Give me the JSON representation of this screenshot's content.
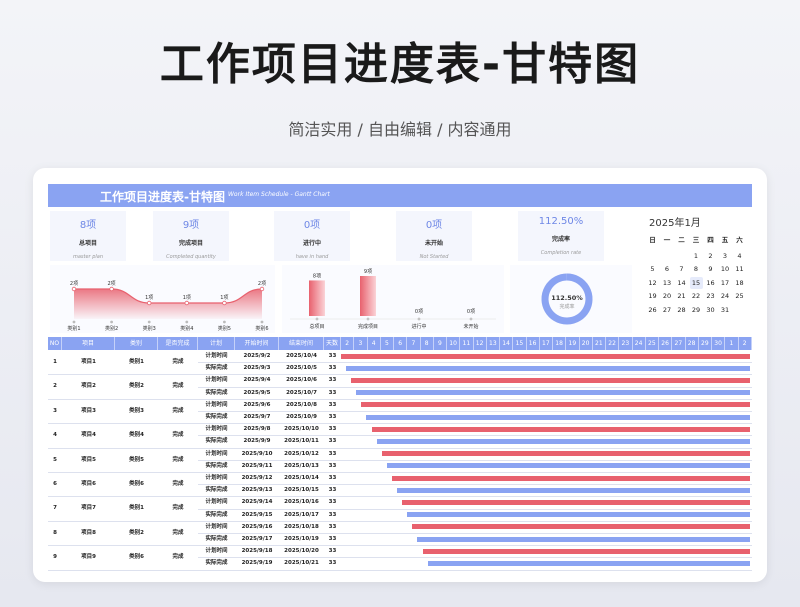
{
  "page": {
    "title": "工作项目进度表-甘特图",
    "subtitle": "简洁实用 / 自由编辑 / 内容通用"
  },
  "banner": {
    "title": "工作项目进度表-甘特图",
    "subtitle": "Work Item Schedule - Gantt Chart"
  },
  "kpis": [
    {
      "value": "8项",
      "label": "总项目",
      "label_en": "master plan"
    },
    {
      "value": "9项",
      "label": "完成项目",
      "label_en": "Completed quantity"
    },
    {
      "value": "0项",
      "label": "进行中",
      "label_en": "have in hand"
    },
    {
      "value": "0项",
      "label": "未开始",
      "label_en": "Not Started"
    },
    {
      "value": "112.50%",
      "label": "完成率",
      "label_en": "Completion rate"
    }
  ],
  "calendar": {
    "title": "2025年1月",
    "weekdays": [
      "日",
      "一",
      "二",
      "三",
      "四",
      "五",
      "六"
    ],
    "weeks": [
      [
        "",
        "",
        "",
        "1",
        "2",
        "3",
        "4"
      ],
      [
        "5",
        "6",
        "7",
        "8",
        "9",
        "10",
        "11"
      ],
      [
        "12",
        "13",
        "14",
        "15",
        "16",
        "17",
        "18"
      ],
      [
        "19",
        "20",
        "21",
        "22",
        "23",
        "24",
        "25"
      ],
      [
        "26",
        "27",
        "28",
        "29",
        "30",
        "31",
        ""
      ]
    ],
    "highlight": "15"
  },
  "chart_data": [
    {
      "type": "area",
      "categories": [
        "类别1",
        "类别2",
        "类别3",
        "类别4",
        "类别5",
        "类别6"
      ],
      "values": [
        2,
        2,
        1,
        1,
        1,
        2
      ],
      "data_labels": [
        "2项",
        "2项",
        "1项",
        "1项",
        "1项",
        "2项"
      ],
      "color": "#e8616e"
    },
    {
      "type": "bar",
      "categories": [
        "总项目",
        "完成项目",
        "进行中",
        "未开始"
      ],
      "values": [
        8,
        9,
        0,
        0
      ],
      "data_labels": [
        "8项",
        "9项",
        "0项",
        "0项"
      ],
      "color": "#e8616e"
    },
    {
      "type": "pie",
      "center_value": "112.50%",
      "center_label": "完成率",
      "value": 1.125,
      "colors": [
        "#8aa3f2",
        "#dfe5f8"
      ]
    }
  ],
  "gantt": {
    "headers": [
      "NO",
      "项目",
      "类别",
      "是否完成",
      "计划",
      "开始时间",
      "结束时间",
      "天数"
    ],
    "day_columns": [
      "2",
      "3",
      "4",
      "5",
      "6",
      "7",
      "8",
      "9",
      "10",
      "11",
      "12",
      "13",
      "14",
      "15",
      "16",
      "17",
      "18",
      "19",
      "20",
      "21",
      "22",
      "23",
      "24",
      "25",
      "26",
      "27",
      "28",
      "29",
      "30",
      "1",
      "2"
    ],
    "plan_color": "#e8616e",
    "actual_color": "#8aa3f2",
    "rows": [
      {
        "no": "1",
        "project": "项目1",
        "category": "类别1",
        "done": "完成",
        "plan": {
          "label": "计划时间",
          "start": "2025/9/2",
          "end": "2025/10/4",
          "days": "33",
          "offset": 0
        },
        "actual": {
          "label": "实际完成",
          "start": "2025/9/3",
          "end": "2025/10/5",
          "days": "33",
          "offset": 1
        }
      },
      {
        "no": "2",
        "project": "项目2",
        "category": "类别2",
        "done": "完成",
        "plan": {
          "label": "计划时间",
          "start": "2025/9/4",
          "end": "2025/10/6",
          "days": "33",
          "offset": 2
        },
        "actual": {
          "label": "实际完成",
          "start": "2025/9/5",
          "end": "2025/10/7",
          "days": "33",
          "offset": 3
        }
      },
      {
        "no": "3",
        "project": "项目3",
        "category": "类别3",
        "done": "完成",
        "plan": {
          "label": "计划时间",
          "start": "2025/9/6",
          "end": "2025/10/8",
          "days": "33",
          "offset": 4
        },
        "actual": {
          "label": "实际完成",
          "start": "2025/9/7",
          "end": "2025/10/9",
          "days": "33",
          "offset": 5
        }
      },
      {
        "no": "4",
        "project": "项目4",
        "category": "类别4",
        "done": "完成",
        "plan": {
          "label": "计划时间",
          "start": "2025/9/8",
          "end": "2025/10/10",
          "days": "33",
          "offset": 6
        },
        "actual": {
          "label": "实际完成",
          "start": "2025/9/9",
          "end": "2025/10/11",
          "days": "33",
          "offset": 7
        }
      },
      {
        "no": "5",
        "project": "项目5",
        "category": "类别5",
        "done": "完成",
        "plan": {
          "label": "计划时间",
          "start": "2025/9/10",
          "end": "2025/10/12",
          "days": "33",
          "offset": 8
        },
        "actual": {
          "label": "实际完成",
          "start": "2025/9/11",
          "end": "2025/10/13",
          "days": "33",
          "offset": 9
        }
      },
      {
        "no": "6",
        "project": "项目6",
        "category": "类别6",
        "done": "完成",
        "plan": {
          "label": "计划时间",
          "start": "2025/9/12",
          "end": "2025/10/14",
          "days": "33",
          "offset": 10
        },
        "actual": {
          "label": "实际完成",
          "start": "2025/9/13",
          "end": "2025/10/15",
          "days": "33",
          "offset": 11
        }
      },
      {
        "no": "7",
        "project": "项目7",
        "category": "类别1",
        "done": "完成",
        "plan": {
          "label": "计划时间",
          "start": "2025/9/14",
          "end": "2025/10/16",
          "days": "33",
          "offset": 12
        },
        "actual": {
          "label": "实际完成",
          "start": "2025/9/15",
          "end": "2025/10/17",
          "days": "33",
          "offset": 13
        }
      },
      {
        "no": "8",
        "project": "项目8",
        "category": "类别2",
        "done": "完成",
        "plan": {
          "label": "计划时间",
          "start": "2025/9/16",
          "end": "2025/10/18",
          "days": "33",
          "offset": 14
        },
        "actual": {
          "label": "实际完成",
          "start": "2025/9/17",
          "end": "2025/10/19",
          "days": "33",
          "offset": 15
        }
      },
      {
        "no": "9",
        "project": "项目9",
        "category": "类别6",
        "done": "完成",
        "plan": {
          "label": "计划时间",
          "start": "2025/9/18",
          "end": "2025/10/20",
          "days": "33",
          "offset": 16
        },
        "actual": {
          "label": "实际完成",
          "start": "2025/9/19",
          "end": "2025/10/21",
          "days": "33",
          "offset": 17
        }
      }
    ]
  }
}
